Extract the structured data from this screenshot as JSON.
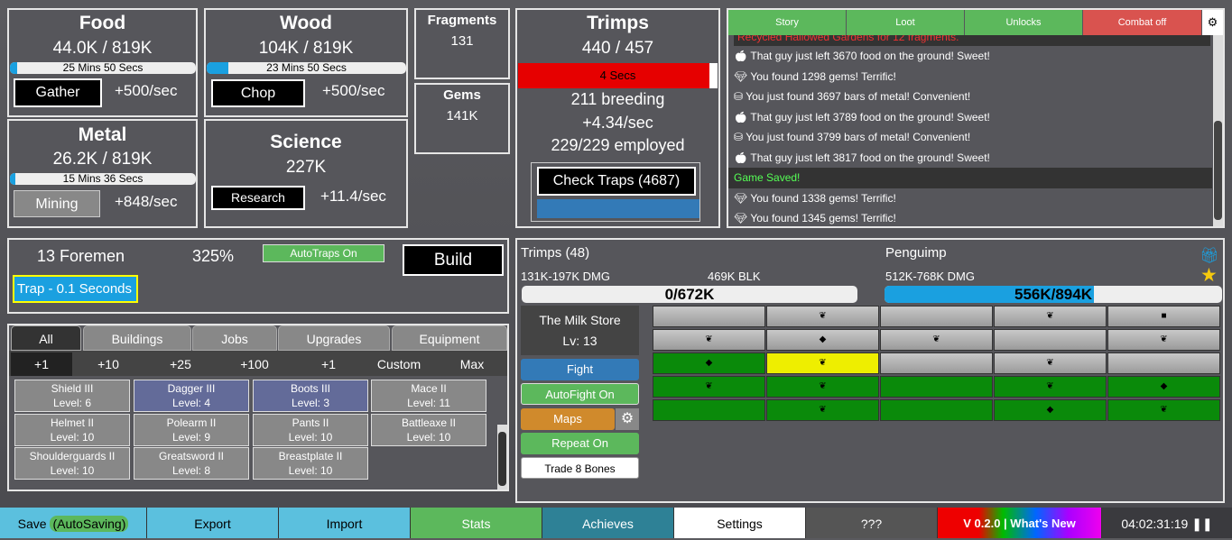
{
  "resources": {
    "food": {
      "title": "Food",
      "amount": "44.0K / 819K",
      "timer": "25 Mins 50 Secs",
      "progress": 0.04,
      "button": "Gather",
      "rate": "+500/sec"
    },
    "wood": {
      "title": "Wood",
      "amount": "104K / 819K",
      "timer": "23 Mins 50 Secs",
      "progress": 0.11,
      "button": "Chop",
      "rate": "+500/sec"
    },
    "metal": {
      "title": "Metal",
      "amount": "26.2K / 819K",
      "timer": "15 Mins 36 Secs",
      "progress": 0.03,
      "button": "Mining",
      "rate": "+848/sec"
    },
    "science": {
      "title": "Science",
      "amount": "227K",
      "button": "Research",
      "rate": "+11.4/sec"
    },
    "fragments": {
      "title": "Fragments",
      "amount": "131"
    },
    "gems": {
      "title": "Gems",
      "amount": "141K"
    }
  },
  "trimps_panel": {
    "title": "Trimps",
    "amount": "440 / 457",
    "breed_timer": "4 Secs",
    "breeding": "211 breeding",
    "rate": "+4.34/sec",
    "employed": "229/229 employed",
    "check_traps": "Check Traps (4687)"
  },
  "log": {
    "tabs": [
      "Story",
      "Loot",
      "Unlocks",
      "Combat off"
    ],
    "settings_icon": "gear-icon",
    "cut_line": "Recycled Hallowed Gardens for 12 fragments.",
    "lines": [
      {
        "icon": "apple",
        "text": "That guy just left 3670 food on the ground! Sweet!"
      },
      {
        "icon": "gem",
        "text": "You found 1298 gems! Terrific!"
      },
      {
        "icon": "metal",
        "text": "You just found 3697 bars of metal! Convenient!"
      },
      {
        "icon": "apple",
        "text": "That guy just left 3789 food on the ground! Sweet!"
      },
      {
        "icon": "metal",
        "text": "You just found 3799 bars of metal! Convenient!"
      },
      {
        "icon": "apple",
        "text": "That guy just left 3817 food on the ground! Sweet!"
      },
      {
        "icon": "",
        "text": "Game Saved!",
        "saved": true
      },
      {
        "icon": "gem",
        "text": "You found 1338 gems! Terrific!"
      },
      {
        "icon": "gem",
        "text": "You found 1345 gems! Terrific!"
      }
    ]
  },
  "build_panel": {
    "foremen": "13 Foremen",
    "percent": "325%",
    "autotraps": "AutoTraps On",
    "build": "Build",
    "trap": "Trap - 0.1 Seconds"
  },
  "shop": {
    "tabs": [
      "All",
      "Buildings",
      "Jobs",
      "Upgrades",
      "Equipment"
    ],
    "amounts": [
      "+1",
      "+10",
      "+25",
      "+100",
      "+1",
      "Custom",
      "Max"
    ],
    "items": [
      {
        "name": "Shield III",
        "level": "Level: 6",
        "style": "normal"
      },
      {
        "name": "Dagger III",
        "level": "Level: 4",
        "style": "blue"
      },
      {
        "name": "Boots III",
        "level": "Level: 3",
        "style": "blue"
      },
      {
        "name": "Mace II",
        "level": "Level: 11",
        "style": "normal"
      },
      {
        "name": "Helmet II",
        "level": "Level: 10",
        "style": "normal"
      },
      {
        "name": "Polearm II",
        "level": "Level: 9",
        "style": "normal"
      },
      {
        "name": "Pants II",
        "level": "Level: 10",
        "style": "normal"
      },
      {
        "name": "Battleaxe II",
        "level": "Level: 10",
        "style": "normal"
      },
      {
        "name": "Shoulderguards II",
        "level": "Level: 10",
        "style": "normal"
      },
      {
        "name": "Greatsword II",
        "level": "Level: 8",
        "style": "normal"
      },
      {
        "name": "Breastplate II",
        "level": "Level: 10",
        "style": "normal"
      }
    ]
  },
  "battle": {
    "trimps": {
      "title": "Trimps (48)",
      "dmg": "131K-197K DMG",
      "blk": "469K BLK",
      "health": "0/672K",
      "health_fill": 0.0
    },
    "enemy": {
      "title": "Penguimp",
      "dmg": "512K-768K DMG",
      "health": "556K/894K",
      "health_fill": 0.62
    },
    "map": {
      "name": "The Milk Store",
      "level": "Lv: 13"
    },
    "buttons": {
      "fight": "Fight",
      "autofight": "AutoFight On",
      "maps": "Maps",
      "repeat": "Repeat On",
      "trade": "Trade 8 Bones"
    },
    "grid": [
      [
        "gray",
        "gray:leaf",
        "gray",
        "gray:leaf",
        "gray:cube"
      ],
      [
        "gray:leaf",
        "gray:gem",
        "gray:leaf",
        "gray",
        "gray:leaf"
      ],
      [
        "green:gem",
        "yellow:leaf",
        "gray",
        "gray:leaf",
        "gray"
      ],
      [
        "green:leaf",
        "green:leaf",
        "green",
        "green:leaf",
        "green:gem"
      ],
      [
        "green",
        "green:leaf",
        "green",
        "green:gem",
        "green:leaf"
      ]
    ]
  },
  "bottom": {
    "save": "Save",
    "autosaving": "(AutoSaving)",
    "export": "Export",
    "import": "Import",
    "stats": "Stats",
    "achieves": "Achieves",
    "settings": "Settings",
    "unknown": "???",
    "version": "V 0.2.0 | What's New",
    "clock": "04:02:31:19"
  },
  "colors": {
    "accent_blue": "#1aa0e0",
    "red": "#e60000",
    "green": "#2e9e2e",
    "log_tab_green": "#5cb85c",
    "log_tab_red": "#d9534f"
  }
}
